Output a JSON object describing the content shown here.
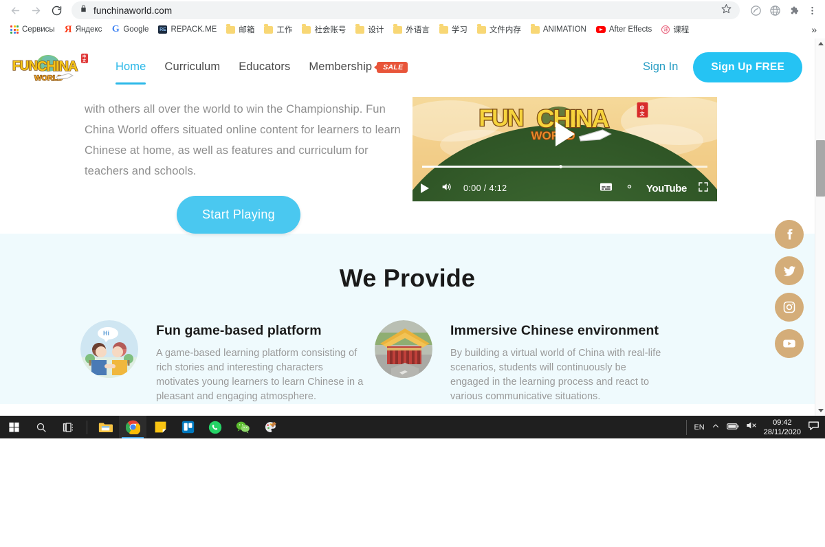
{
  "browser": {
    "back_icon": "back-arrow-icon",
    "forward_icon": "forward-arrow-icon",
    "reload_icon": "reload-icon",
    "url": "funchinaworld.com",
    "lock_icon": "lock-icon",
    "star_icon": "bookmark-star-icon",
    "toolbar_icons": [
      "adblock-icon",
      "globe-icon",
      "extensions-puzzle-icon",
      "three-dot-menu-icon"
    ],
    "overflow_label": "»",
    "bookmarks": [
      {
        "label": "Сервисы",
        "icon": "google-apps-icon"
      },
      {
        "label": "Яндекс",
        "icon": "yandex-icon"
      },
      {
        "label": "Google",
        "icon": "google-icon"
      },
      {
        "label": "REPACK.ME",
        "icon": "repackme-icon"
      },
      {
        "label": "邮箱",
        "icon": "folder-icon"
      },
      {
        "label": "工作",
        "icon": "folder-icon"
      },
      {
        "label": "社会账号",
        "icon": "folder-icon"
      },
      {
        "label": "设计",
        "icon": "folder-icon"
      },
      {
        "label": "外语言",
        "icon": "folder-icon"
      },
      {
        "label": "学习",
        "icon": "folder-icon"
      },
      {
        "label": "文件内存",
        "icon": "folder-icon"
      },
      {
        "label": "ANIMATION",
        "icon": "folder-icon"
      },
      {
        "label": "After Effects",
        "icon": "youtube-icon"
      },
      {
        "label": "课程",
        "icon": "stamp-icon"
      }
    ]
  },
  "site": {
    "logo_text": "FUN CHINA WORLD",
    "nav": [
      {
        "label": "Home",
        "active": true
      },
      {
        "label": "Curriculum",
        "active": false
      },
      {
        "label": "Educators",
        "active": false
      },
      {
        "label": "Membership",
        "active": false,
        "badge": "SALE"
      }
    ],
    "sign_in": "Sign In",
    "sign_up": "Sign Up FREE",
    "accent_color": "#25c3f3",
    "nav_active_color": "#2bb8e8",
    "sale_badge_color": "#e8553a"
  },
  "hero": {
    "paragraph": "with others all over the world to win the Championship. Fun China World offers situated online content for learners to learn Chinese at home, as well as features and curriculum for teachers and schools.",
    "cta_label": "Start Playing"
  },
  "video": {
    "title_logo": "FUN CHINA WORLD",
    "play_icon": "play-button-icon",
    "mute_icon": "volume-icon",
    "time": "0:00 / 4:12",
    "captions_icon": "subtitles-icon",
    "settings_icon": "gear-icon",
    "brand": "YouTube",
    "fullscreen_icon": "fullscreen-icon",
    "progress_percent": 48
  },
  "provide": {
    "heading": "We Provide",
    "background_color": "#effafd",
    "cards": [
      {
        "title": "Fun game-based platform",
        "text": "A game-based learning platform consisting of rich stories and interesting characters motivates young learners to learn Chinese in a pleasant and engaging atmosphere.",
        "image": "two-kids-greeting-illustration"
      },
      {
        "title": "Immersive Chinese environment",
        "text": "By building a virtual world of China with real-life scenarios, students will continuously be engaged in the learning process and react to various communicative situations.",
        "image": "chinese-temple-illustration"
      }
    ]
  },
  "social": {
    "color": "#d4ad79",
    "items": [
      {
        "name": "facebook",
        "icon": "facebook-icon"
      },
      {
        "name": "twitter",
        "icon": "twitter-icon"
      },
      {
        "name": "instagram",
        "icon": "instagram-icon"
      },
      {
        "name": "youtube",
        "icon": "youtube-icon"
      }
    ]
  },
  "taskbar": {
    "items": [
      {
        "name": "start",
        "icon": "windows-start-icon"
      },
      {
        "name": "search",
        "icon": "search-icon"
      },
      {
        "name": "task-view",
        "icon": "task-view-icon"
      },
      {
        "name": "file-explorer",
        "icon": "file-explorer-icon"
      },
      {
        "name": "chrome",
        "icon": "chrome-icon",
        "active": true
      },
      {
        "name": "sticky-notes",
        "icon": "sticky-notes-icon"
      },
      {
        "name": "trello",
        "icon": "trello-icon"
      },
      {
        "name": "whatsapp",
        "icon": "whatsapp-icon"
      },
      {
        "name": "wechat",
        "icon": "wechat-icon"
      },
      {
        "name": "paint-3d",
        "icon": "paint-3d-icon"
      }
    ],
    "tray": {
      "language": "EN",
      "show_hidden_icon": "chevron-up-icon",
      "battery_icon": "battery-icon",
      "volume_icon": "volume-muted-icon",
      "time": "09:42",
      "date": "28/11/2020",
      "notifications_icon": "notification-icon"
    }
  }
}
